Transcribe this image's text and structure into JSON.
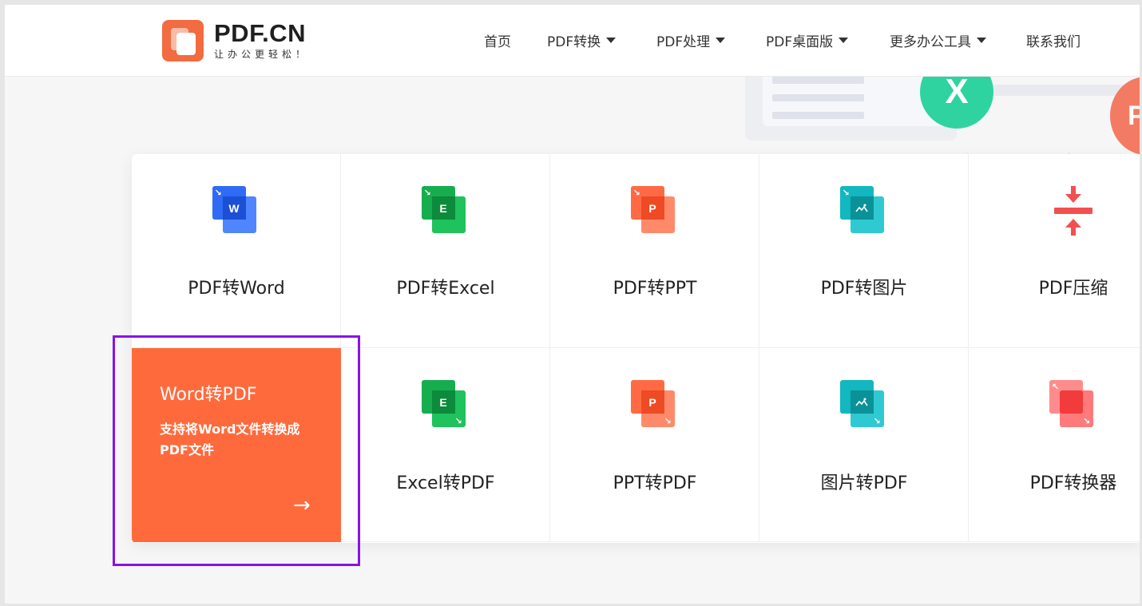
{
  "header": {
    "logo_title": "PDF.CN",
    "logo_subtitle": "让办公更轻松！",
    "nav": [
      {
        "label": "首页",
        "dropdown": false
      },
      {
        "label": "PDF转换",
        "dropdown": true
      },
      {
        "label": "PDF处理",
        "dropdown": true
      },
      {
        "label": "PDF桌面版",
        "dropdown": true
      },
      {
        "label": "更多办公工具",
        "dropdown": true
      },
      {
        "label": "联系我们",
        "dropdown": false
      }
    ]
  },
  "hero": {
    "badge_x": "X",
    "badge_p": "P"
  },
  "tools": {
    "row1": [
      {
        "label": "PDF转Word",
        "icon": "word-icon",
        "letter": "W",
        "color": "#2f6bf5"
      },
      {
        "label": "PDF转Excel",
        "icon": "excel-icon",
        "letter": "E",
        "color": "#16ad4f"
      },
      {
        "label": "PDF转PPT",
        "icon": "ppt-icon",
        "letter": "P",
        "color": "#ff6a45"
      },
      {
        "label": "PDF转图片",
        "icon": "image-icon",
        "letter": "",
        "color": "#13b7bf"
      },
      {
        "label": "PDF压缩",
        "icon": "compress-icon",
        "letter": "",
        "color": "#f25050"
      }
    ],
    "row2": [
      {
        "label": "Word转PDF",
        "description": "支持将Word文件转换成PDF文件",
        "arrow": "→",
        "active": true
      },
      {
        "label": "Excel转PDF",
        "icon": "excel-icon",
        "letter": "E",
        "color": "#16ad4f"
      },
      {
        "label": "PPT转PDF",
        "icon": "ppt-icon",
        "letter": "P",
        "color": "#ff6a45"
      },
      {
        "label": "图片转PDF",
        "icon": "image-icon",
        "letter": "",
        "color": "#13b7bf"
      },
      {
        "label": "PDF转换器",
        "icon": "converter-icon",
        "letter": "",
        "color": "#f25050"
      }
    ]
  },
  "highlight_color": "#8a12e6"
}
